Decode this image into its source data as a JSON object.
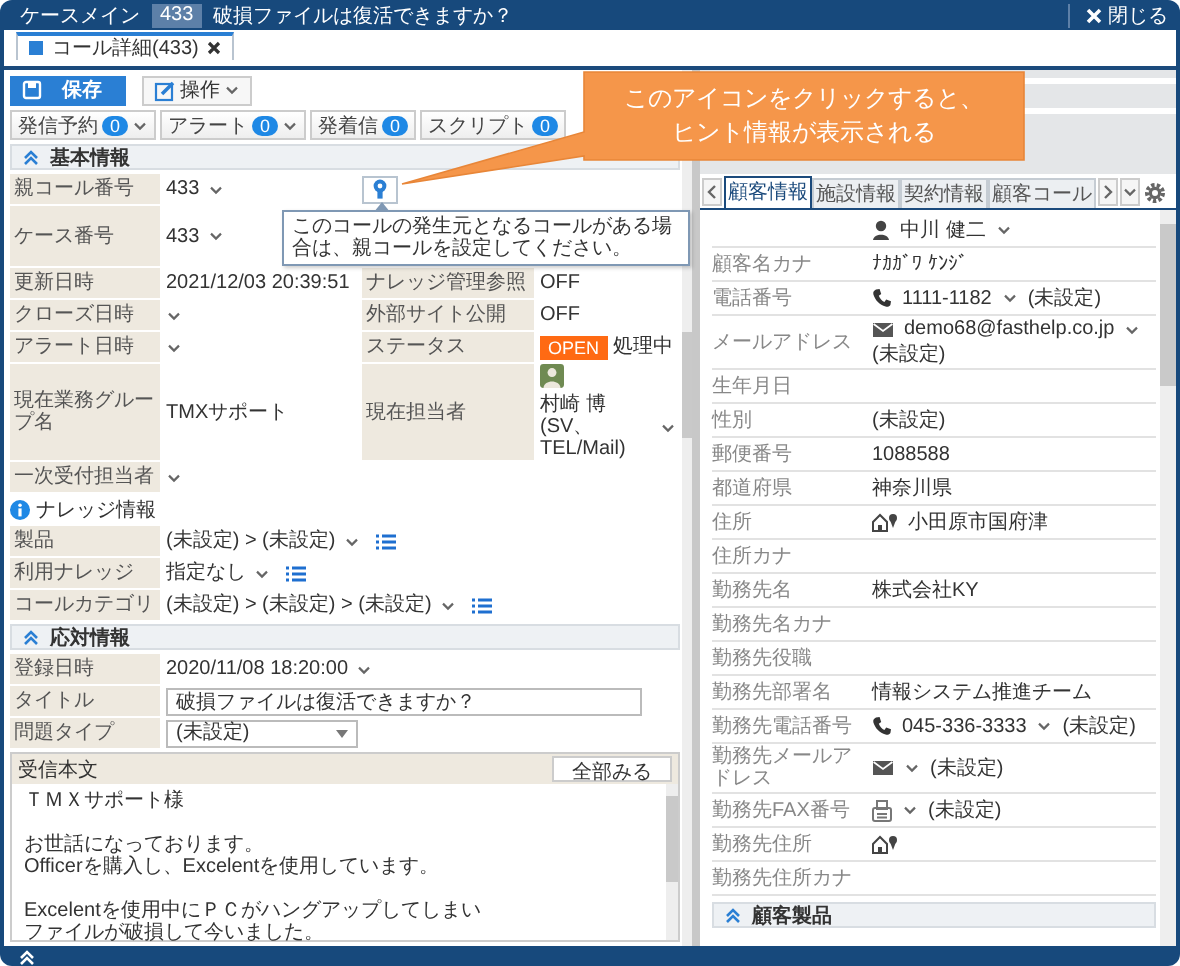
{
  "title_bar": {
    "app": "ケースメイン",
    "case_id": "433",
    "title": "破損ファイルは復活できますか？",
    "close": "閉じる"
  },
  "tabs": [
    {
      "label": "コール詳細(433)",
      "selected": true
    }
  ],
  "toolbar": {
    "save": "保存",
    "actions": "操作"
  },
  "counters": [
    {
      "label": "発信予約",
      "count": "0",
      "dropdown": true
    },
    {
      "label": "アラート",
      "count": "0",
      "dropdown": true
    },
    {
      "label": "発着信",
      "count": "0"
    },
    {
      "label": "スクリプト",
      "count": "0"
    }
  ],
  "callout": {
    "text": "このアイコンをクリックすると、ヒント情報が表示される"
  },
  "basic_info": {
    "title": "基本情報",
    "expanded": true,
    "rows": [
      {
        "label": "親コール番号",
        "value": "433",
        "dropdown": true,
        "side": {
          "kind": "hint",
          "tooltip": "このコールの発生元となるコールがある場合は、親コールを設定してください。"
        }
      },
      {
        "label": "ケース番号",
        "value": "433",
        "dropdown": true
      },
      {
        "label": "更新日時",
        "value": "2021/12/03 20:39:51",
        "side": {
          "kind": "text",
          "label": "ナレッジ管理参照",
          "value": "OFF"
        }
      },
      {
        "label": "クローズ日時",
        "dropdown": true,
        "side": {
          "kind": "text",
          "label": "外部サイト公開",
          "value": "OFF"
        }
      },
      {
        "label": "アラート日時",
        "dropdown": true,
        "side": {
          "kind": "status",
          "label": "ステータス",
          "badge": "OPEN",
          "value": "処理中"
        }
      },
      {
        "label": "現在業務グループ名",
        "value": "TMXサポート",
        "side": {
          "kind": "user",
          "label": "現在担当者",
          "value": "村崎 博(SV、TEL/Mail)",
          "dropdown": true
        }
      },
      {
        "label": "一次受付担当者",
        "dropdown": true
      }
    ]
  },
  "knowledge": {
    "label": "ナレッジ情報",
    "rows": [
      {
        "label": "製品",
        "value": "(未設定) > (未設定)"
      },
      {
        "label": "利用ナレッジ",
        "value": "指定なし"
      },
      {
        "label": "コールカテゴリ",
        "value": "(未設定) > (未設定) > (未設定)"
      }
    ]
  },
  "response_info": {
    "title": "応対情報",
    "expanded": true,
    "rows": [
      {
        "kind": "date",
        "label": "登録日時",
        "value": "2020/11/08 18:20:00"
      },
      {
        "kind": "input",
        "label": "タイトル",
        "value": "破損ファイルは復活できますか？"
      },
      {
        "kind": "select",
        "label": "問題タイプ",
        "value": "(未設定)"
      }
    ]
  },
  "body": {
    "label": "受信本文",
    "button": "全部みる",
    "paragraphs": [
      [
        "ＴＭＸサポート様"
      ],
      [
        "お世話になっております。",
        "Officerを購入し、Excelentを使用しています。"
      ],
      [
        "Excelentを使用中にＰＣがハングアップしてしまい",
        "ファイルが破損して今いました。"
      ]
    ]
  },
  "customer_tabs": [
    {
      "label": "顧客情報",
      "selected": true
    },
    {
      "label": "施設情報",
      "selected": false
    },
    {
      "label": "契約情報",
      "selected": false
    },
    {
      "label": "顧客コール",
      "selected": false
    }
  ],
  "customer_rows": [
    {
      "kind": "person",
      "value": "中川 健二",
      "dropdown": true
    },
    {
      "kind": "text",
      "label": "顧客名カナ",
      "value": "ﾅｶｶﾞﾜ ｹﾝｼﾞ"
    },
    {
      "kind": "phone",
      "label": "電話番号",
      "value": "1111-1182",
      "dropdown": true,
      "note": "(未設定)"
    },
    {
      "kind": "mail",
      "label": "メールアドレス",
      "value": "demo68@fasthelp.co.jp",
      "dropdown": true,
      "note": "(未設定)"
    },
    {
      "kind": "text",
      "label": "生年月日"
    },
    {
      "kind": "text",
      "label": "性別",
      "value": "(未設定)"
    },
    {
      "kind": "text",
      "label": "郵便番号",
      "value": "1088588"
    },
    {
      "kind": "text",
      "label": "都道府県",
      "value": "神奈川県"
    },
    {
      "kind": "address",
      "label": "住所",
      "value": "小田原市国府津"
    },
    {
      "kind": "text",
      "label": "住所カナ"
    },
    {
      "kind": "text",
      "label": "勤務先名",
      "value": "株式会社KY"
    },
    {
      "kind": "text",
      "label": "勤務先名カナ"
    },
    {
      "kind": "text",
      "label": "勤務先役職"
    },
    {
      "kind": "text",
      "label": "勤務先部署名",
      "value": "情報システム推進チーム"
    },
    {
      "kind": "phone",
      "label": "勤務先電話番号",
      "value": "045-336-3333",
      "dropdown": true,
      "note": "(未設定)"
    },
    {
      "kind": "mail",
      "label": "勤務先メールアドレス",
      "dropdown": true,
      "note": "(未設定)"
    },
    {
      "kind": "fax",
      "label": "勤務先FAX番号",
      "dropdown": true,
      "note": "(未設定)"
    },
    {
      "kind": "address",
      "label": "勤務先住所"
    },
    {
      "kind": "text",
      "label": "勤務先住所カナ"
    }
  ],
  "customer_products": {
    "title": "顧客製品",
    "expanded": true
  }
}
